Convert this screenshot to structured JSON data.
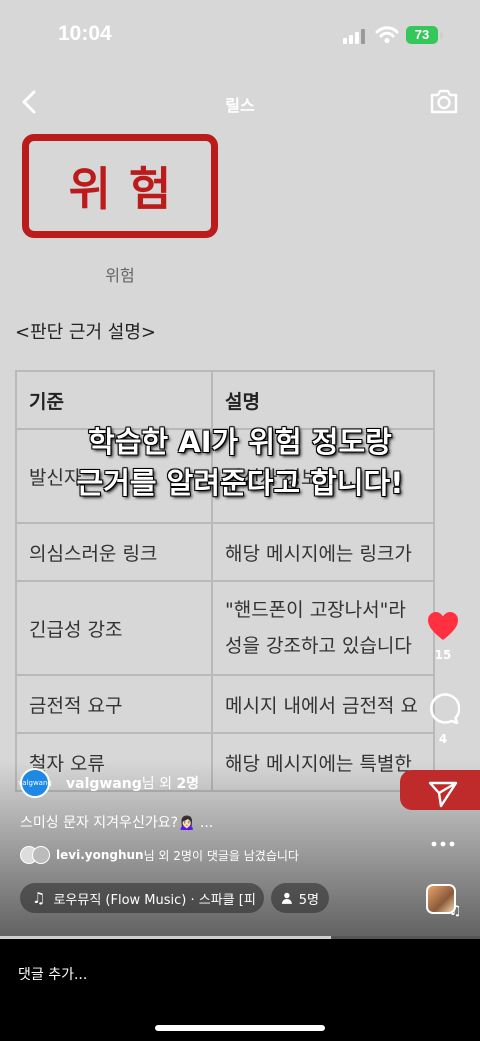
{
  "status_bar": {
    "time": "10:04",
    "battery": "73"
  },
  "header": {
    "title": "릴스"
  },
  "content": {
    "badge_text": "위험",
    "badge_caption": "위험",
    "section_title": "<판단 근거 설명>",
    "table": {
      "headers": [
        "기준",
        "설명"
      ],
      "rows": [
        [
          "발신자",
          "발신자 정보가 ..."
        ],
        [
          "의심스러운 링크",
          "해당 메시지에는 링크가"
        ],
        [
          "긴급성 강조",
          "\"핸드폰이 고장나서\"라"
        ],
        [
          "",
          "성을 강조하고 있습니다"
        ],
        [
          "금전적 요구",
          "메시지 내에서 금전적 요"
        ],
        [
          "철자 오류",
          "해당 메시지에는 특별한"
        ]
      ]
    },
    "overlay_lines": [
      "학습한 AI가 위험 정도랑",
      "근거를 알려준다고 합니다!"
    ]
  },
  "actions": {
    "like_count": "15",
    "comment_count": "4"
  },
  "post": {
    "author": "valgwang",
    "author_suffix": "님 외 ",
    "author_count": "2명",
    "avatar_text": "valgwang",
    "caption": "스미싱 문자 지겨우신가요?🙍🏻‍♀️ ...",
    "comments_user": "levi.yonghun",
    "comments_text": "님 외 2명이 댓글을 남겼습니다",
    "music": "로우뮤직 (Flow Music) · 스파클 [피",
    "viewers": "5명"
  },
  "progress_fraction": 0.69,
  "comment_placeholder": "댓글 추가...",
  "colors": {
    "like": "#ff3040",
    "danger": "#bb1b1b",
    "battery": "#34c759"
  }
}
